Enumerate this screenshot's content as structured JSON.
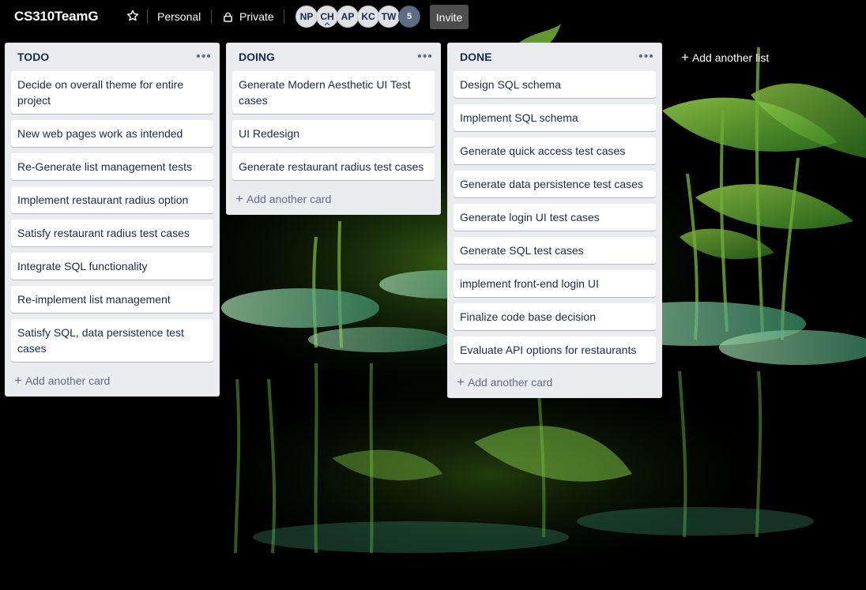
{
  "board": {
    "title": "CS310TeamG",
    "visibility_team": "Personal",
    "visibility_privacy": "Private",
    "invite_label": "Invite",
    "members": [
      "NP",
      "CH",
      "AP",
      "KC",
      "TW"
    ],
    "more_members": "5"
  },
  "lists": [
    {
      "title": "TODO",
      "cards": [
        "Decide on overall theme for entire project",
        "New web pages work as intended",
        "Re-Generate list management tests",
        "Implement restaurant radius option",
        "Satisfy restaurant radius test cases",
        "Integrate SQL functionality",
        "Re-implement list management",
        "Satisfy SQL, data persistence test cases"
      ],
      "add_card_label": "Add another card"
    },
    {
      "title": "DOING",
      "cards": [
        "Generate Modern Aesthetic UI Test cases",
        "UI Redesign",
        "Generate restaurant radius test cases"
      ],
      "add_card_label": "Add another card"
    },
    {
      "title": "DONE",
      "cards": [
        "Design SQL schema",
        "Implement SQL schema",
        "Generate quick access test cases",
        "Generate data persistence test cases",
        "Generate login UI test cases",
        "Generate SQL test cases",
        "implement front-end login UI",
        "Finalize code base decision",
        "Evaluate API options for restaurants"
      ],
      "add_card_label": "Add another card"
    }
  ],
  "add_list_label": "Add another list",
  "icons": {
    "star": "star-icon",
    "lock": "lock-icon",
    "list_menu": "more-horizontal-icon",
    "add": "plus-icon"
  },
  "colors": {
    "list_bg": "#ebecf0",
    "card_text": "#172b4d",
    "muted_text": "#5e6c84",
    "header_text": "#ffffff"
  }
}
